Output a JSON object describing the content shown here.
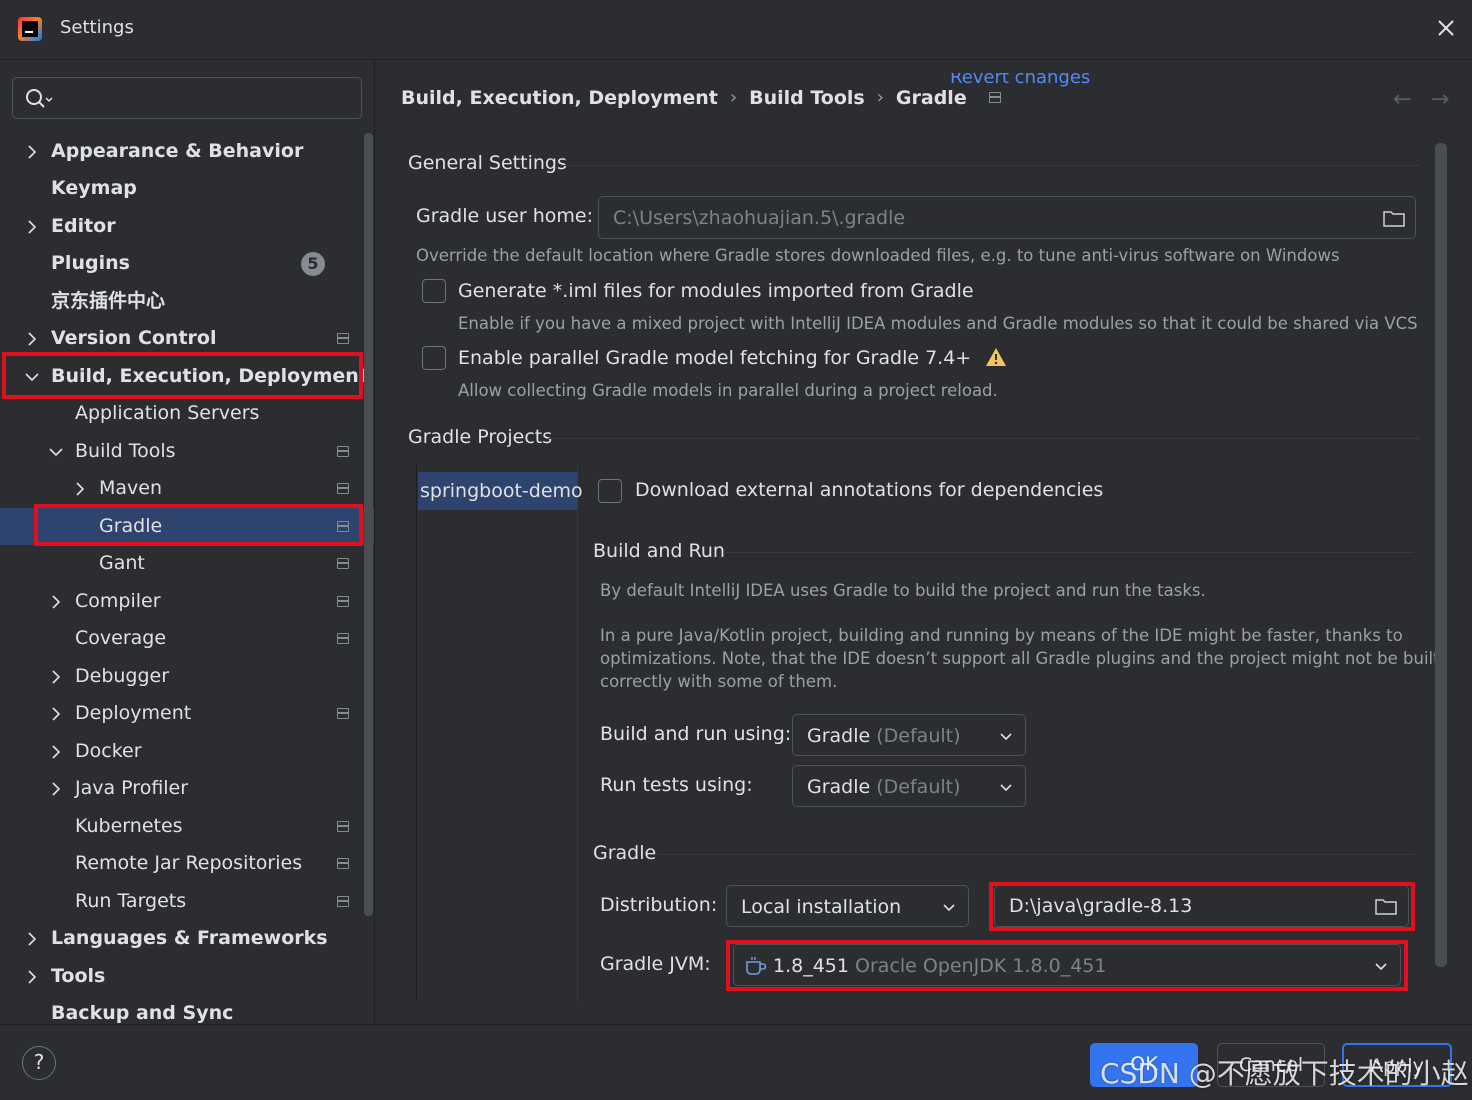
{
  "window": {
    "title": "Settings"
  },
  "search": {
    "placeholder": ""
  },
  "sidebar": {
    "items": [
      {
        "label": "Appearance & Behavior"
      },
      {
        "label": "Keymap"
      },
      {
        "label": "Editor"
      },
      {
        "label": "Plugins",
        "badge": "5"
      },
      {
        "label": "京东插件中心"
      },
      {
        "label": "Version Control"
      },
      {
        "label": "Build, Execution, Deployment"
      },
      {
        "label": "Application Servers"
      },
      {
        "label": "Build Tools"
      },
      {
        "label": "Maven"
      },
      {
        "label": "Gradle"
      },
      {
        "label": "Gant"
      },
      {
        "label": "Compiler"
      },
      {
        "label": "Coverage"
      },
      {
        "label": "Debugger"
      },
      {
        "label": "Deployment"
      },
      {
        "label": "Docker"
      },
      {
        "label": "Java Profiler"
      },
      {
        "label": "Kubernetes"
      },
      {
        "label": "Remote Jar Repositories"
      },
      {
        "label": "Run Targets"
      },
      {
        "label": "Languages & Frameworks"
      },
      {
        "label": "Tools"
      },
      {
        "label": "Backup and Sync"
      }
    ]
  },
  "header": {
    "breadcrumb": [
      "Build, Execution, Deployment",
      "Build Tools",
      "Gradle"
    ],
    "revert": "Revert changes"
  },
  "general": {
    "title": "General Settings",
    "user_home_label": "Gradle user home:",
    "user_home_value": "C:\\Users\\zhaohuajian.5\\.gradle",
    "user_home_help": "Override the default location where Gradle stores downloaded files, e.g. to tune anti-virus software on Windows",
    "iml_label": "Generate *.iml files for modules imported from Gradle",
    "iml_help": "Enable if you have a mixed project with IntelliJ IDEA modules and Gradle modules so that it could be shared via VCS",
    "parallel_label": "Enable parallel Gradle model fetching for Gradle 7.4+",
    "parallel_help": "Allow collecting Gradle models in parallel during a project reload."
  },
  "projects": {
    "title": "Gradle Projects",
    "selected": "springboot-demo",
    "download_annotations": "Download external annotations for dependencies",
    "build_run": {
      "title": "Build and Run",
      "desc1": "By default IntelliJ IDEA uses Gradle to build the project and run the tasks.",
      "desc2_line1": "In a pure Java/Kotlin project, building and running by means of the IDE might be faster, thanks to",
      "desc2_line2": "optimizations. Note, that the IDE doesn’t support all Gradle plugins and the project might not be built",
      "desc2_line3": "correctly with some of them.",
      "build_using_label": "Build and run using:",
      "build_using_value": "Gradle",
      "build_using_suffix": "(Default)",
      "tests_using_label": "Run tests using:",
      "tests_using_value": "Gradle",
      "tests_using_suffix": "(Default)"
    },
    "gradle": {
      "title": "Gradle",
      "distribution_label": "Distribution:",
      "distribution_value": "Local installation",
      "path_value": "D:\\java\\gradle-8.13",
      "jvm_label": "Gradle JVM:",
      "jvm_value": "1.8_451",
      "jvm_detail": "Oracle OpenJDK 1.8.0_451"
    }
  },
  "footer": {
    "help": "?",
    "ok": "OK",
    "cancel": "Cancel",
    "apply": "Apply"
  },
  "watermark": "CSDN @不愿放下技术的小赵",
  "colors": {
    "accent": "#3574f0",
    "highlight": "#e0111f",
    "selection": "#2e436e",
    "link": "#548af7"
  }
}
